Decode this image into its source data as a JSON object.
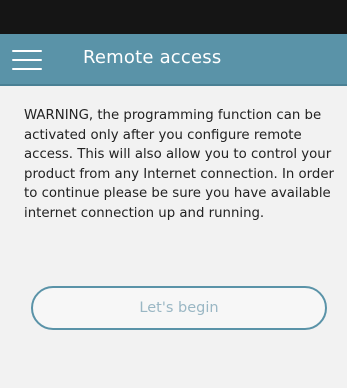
{
  "header": {
    "title": "Remote access",
    "menu_icon": "hamburger-menu-icon"
  },
  "main": {
    "warning": "WARNING, the programming function can be activated only after you configure remote access. This will also allow you to control your product from any Internet connection. In order to continue please be sure you have available internet connection up and running.",
    "begin_button_label": "Let's begin"
  },
  "colors": {
    "status_bar": "#151515",
    "app_bar": "#5a93a8",
    "background": "#f2f2f2",
    "button_border": "#5a93a8",
    "button_text": "#9ab7c4"
  }
}
